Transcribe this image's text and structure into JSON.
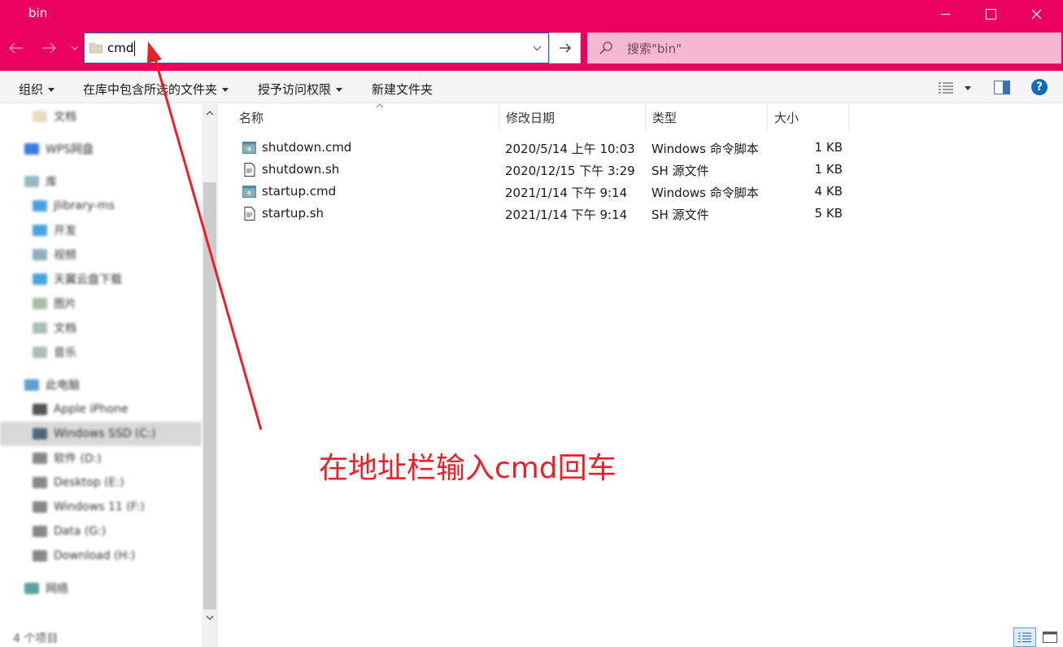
{
  "window": {
    "title": "bin"
  },
  "address": {
    "value": "cmd"
  },
  "search": {
    "placeholder": "搜索\"bin\""
  },
  "commandbar": {
    "organize": "组织",
    "include_in_library": "在库中包含所选的文件夹",
    "share_with": "授予访问权限",
    "new_folder": "新建文件夹"
  },
  "columns": {
    "name": "名称",
    "date": "修改日期",
    "type": "类型",
    "size": "大小"
  },
  "files": [
    {
      "name": "shutdown.cmd",
      "date": "2020/5/14 上午 10:03",
      "type": "Windows 命令脚本",
      "size": "1 KB",
      "icon": "cmd-file-icon"
    },
    {
      "name": "shutdown.sh",
      "date": "2020/12/15 下午 3:29",
      "type": "SH 源文件",
      "size": "1 KB",
      "icon": "text-file-icon"
    },
    {
      "name": "startup.cmd",
      "date": "2021/1/14 下午 9:14",
      "type": "Windows 命令脚本",
      "size": "4 KB",
      "icon": "cmd-file-icon"
    },
    {
      "name": "startup.sh",
      "date": "2021/1/14 下午 9:14",
      "type": "SH 源文件",
      "size": "5 KB",
      "icon": "text-file-icon"
    }
  ],
  "navpane": {
    "items": [
      {
        "label": "文档",
        "color": "#e8dcc0"
      },
      {
        "label": "WPS网盘",
        "color": "#3b7be0"
      },
      {
        "label": "库",
        "color": "#9bb8c8"
      },
      {
        "label": "Jlibrary-ms",
        "color": "#4aa3df"
      },
      {
        "label": "开发",
        "color": "#4aa3df"
      },
      {
        "label": "视频",
        "color": "#8fb0c0"
      },
      {
        "label": "天翼云盘下载",
        "color": "#4aa3df"
      },
      {
        "label": "图片",
        "color": "#a8c0a0"
      },
      {
        "label": "文档",
        "color": "#a8c0b8"
      },
      {
        "label": "音乐",
        "color": "#a8c0b8"
      },
      {
        "label": "此电脑",
        "color": "#5aa0d0"
      },
      {
        "label": "Apple iPhone",
        "color": "#555555"
      },
      {
        "label": "Windows SSD (C:)",
        "color": "#4a6a7a"
      },
      {
        "label": "软件 (D:)",
        "color": "#888888"
      },
      {
        "label": "Desktop (E:)",
        "color": "#888888"
      },
      {
        "label": "Windows 11 (F:)",
        "color": "#888888"
      },
      {
        "label": "Data (G:)",
        "color": "#888888"
      },
      {
        "label": "Download (H:)",
        "color": "#888888"
      },
      {
        "label": "网络",
        "color": "#5aa0a0"
      }
    ],
    "status": "4 个项目"
  },
  "annotation": {
    "text": "在地址栏输入cmd回车",
    "color": "#e8202a"
  },
  "colors": {
    "accent": "#ea005e",
    "search_bg": "#f6b8d0"
  }
}
